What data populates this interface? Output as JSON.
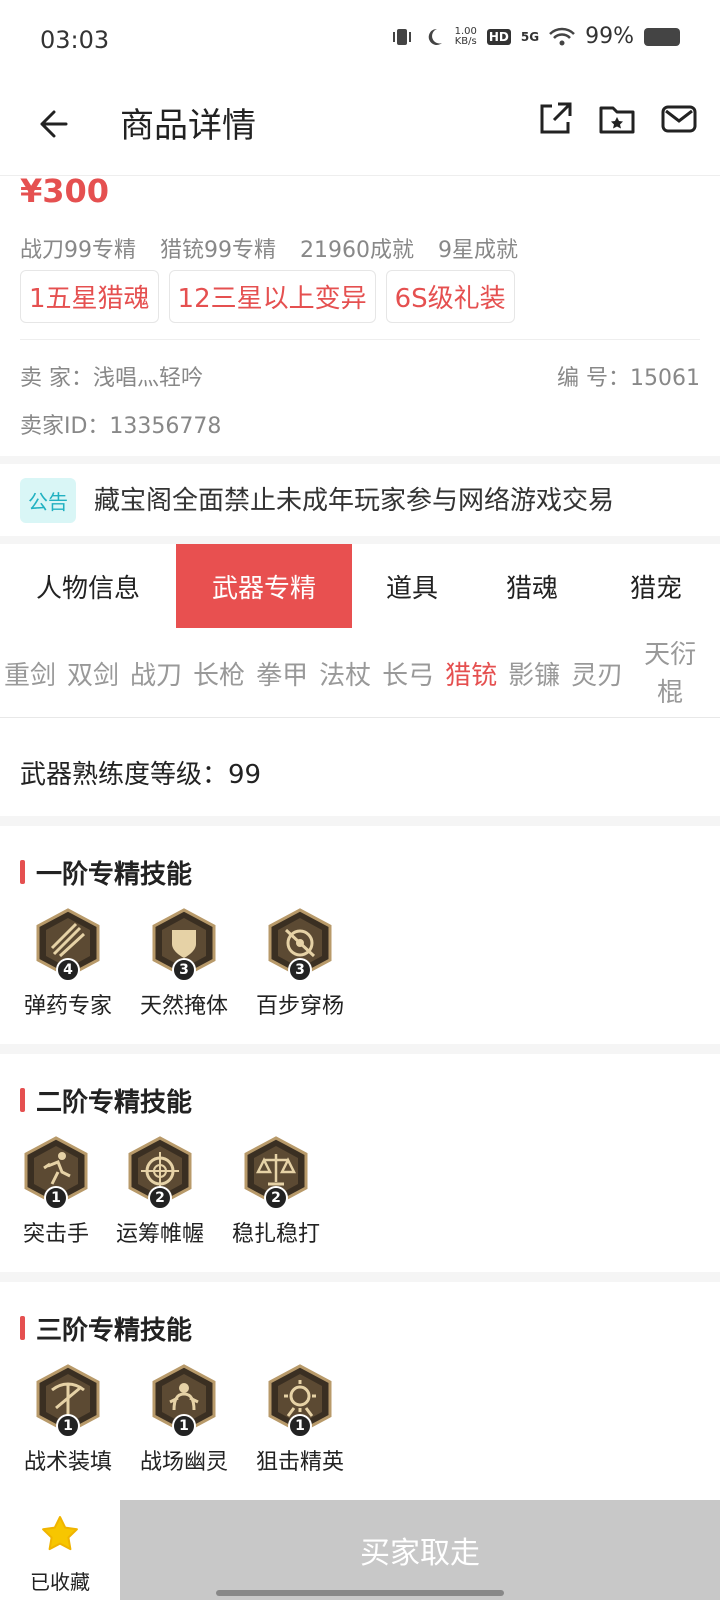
{
  "status_bar": {
    "time": "03:03",
    "net_speed_value": "1.00",
    "net_speed_unit": "KB/s",
    "hd": "HD",
    "network": "5G",
    "battery": "99%"
  },
  "nav": {
    "title": "商品详情",
    "icons": [
      "back-arrow-icon",
      "share-icon",
      "folder-icon",
      "mail-icon"
    ]
  },
  "summary": {
    "price": "¥300",
    "specs": [
      "战刀99专精",
      "猎铳99专精",
      "21960成就",
      "9星成就"
    ],
    "tags": [
      "1五星猎魂",
      "12三星以上变异",
      "6S级礼装"
    ],
    "seller": "卖   家：浅唱灬轻吟",
    "seller_id": "卖家ID：13356778",
    "serial": "编   号：15061"
  },
  "notice": {
    "badge": "公告",
    "text": "藏宝阁全面禁止未成年玩家参与网络游戏交易"
  },
  "tabs": [
    "人物信息",
    "武器专精",
    "道具",
    "猎魂",
    "猎宠"
  ],
  "active_tab": "武器专精",
  "weapon_tabs": [
    "重剑",
    "双剑",
    "战刀",
    "长枪",
    "拳甲",
    "法杖",
    "长弓",
    "猎铳",
    "影镰",
    "灵刃"
  ],
  "weapon_tab_last_1": "天衍",
  "weapon_tab_last_2": "棍",
  "active_weapon": "猎铳",
  "level_text": "武器熟练度等级：99",
  "sections": [
    {
      "title": "一阶专精技能",
      "skills": [
        {
          "name": "弹药专家",
          "level": "4",
          "icon": "ammo-icon"
        },
        {
          "name": "天然掩体",
          "level": "3",
          "icon": "shield-icon"
        },
        {
          "name": "百步穿杨",
          "level": "3",
          "icon": "target-icon"
        }
      ]
    },
    {
      "title": "二阶专精技能",
      "skills": [
        {
          "name": "突击手",
          "level": "1",
          "icon": "runner-icon"
        },
        {
          "name": "运筹帷幄",
          "level": "2",
          "icon": "crosshair-icon"
        },
        {
          "name": "稳扎稳打",
          "level": "2",
          "icon": "scale-icon"
        }
      ]
    },
    {
      "title": "三阶专精技能",
      "skills": [
        {
          "name": "战术装填",
          "level": "1",
          "icon": "crossbow-icon"
        },
        {
          "name": "战场幽灵",
          "level": "1",
          "icon": "ghost-icon"
        },
        {
          "name": "狙击精英",
          "level": "1",
          "icon": "sniper-icon"
        }
      ]
    }
  ],
  "bottom": {
    "fav_label": "已收藏",
    "buy_label": "买家取走",
    "colors": {
      "accent": "#e85050",
      "star": "#f7c600",
      "disabled": "#c8c8c8"
    }
  }
}
